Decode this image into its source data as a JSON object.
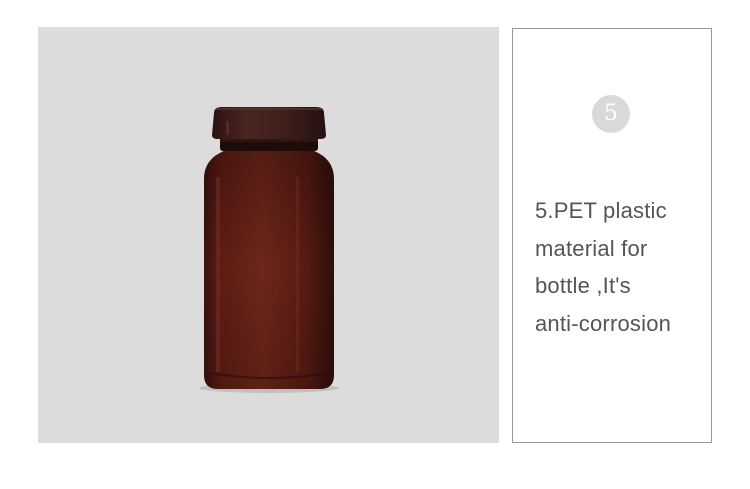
{
  "product_photo": {
    "background_color": "#dcdcdc",
    "bottle_color": "#5a1f16",
    "cap_color": "#3d1d18"
  },
  "feature": {
    "step_number": "5",
    "lines": [
      "5.PET plastic",
      "material for",
      "bottle ,It's",
      "anti-corrosion"
    ]
  }
}
